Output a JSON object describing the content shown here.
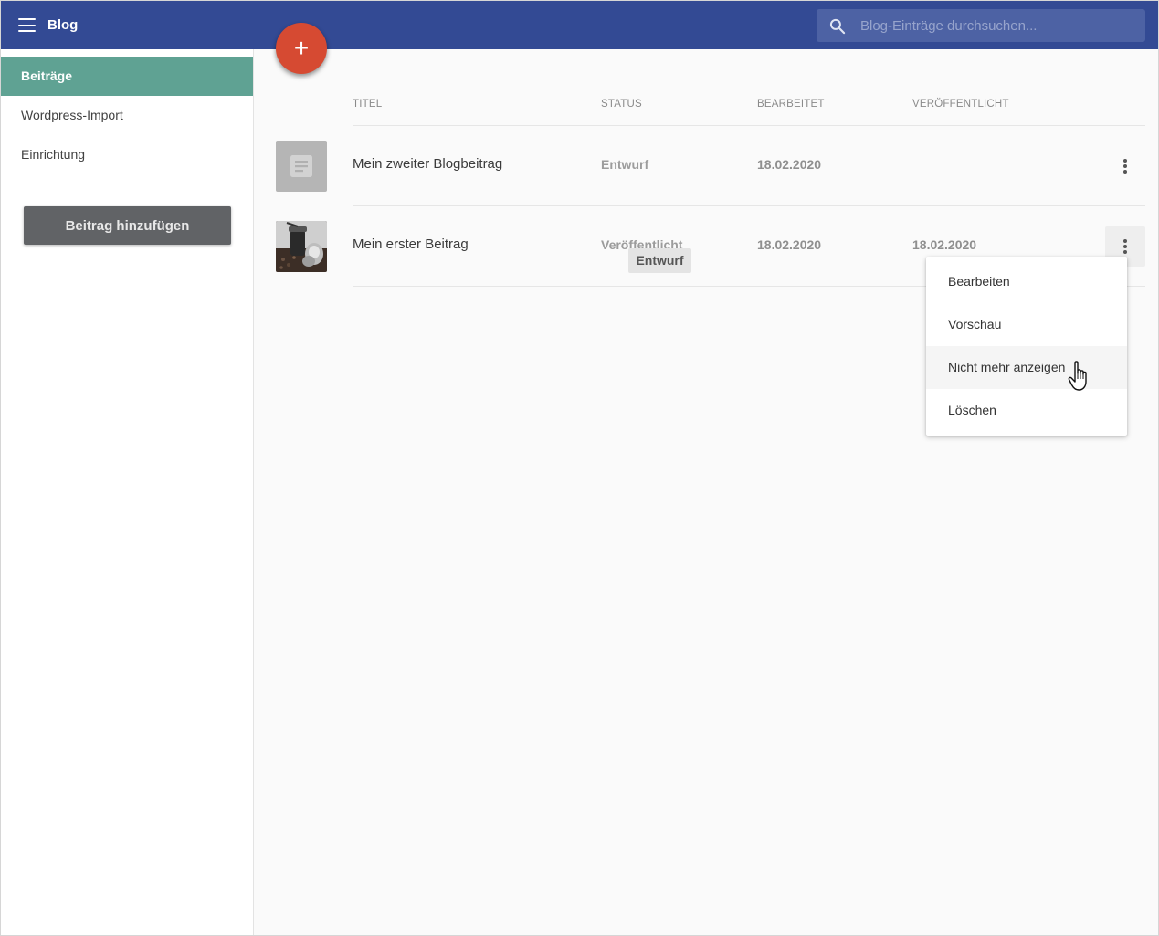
{
  "header": {
    "title": "Blog",
    "search_placeholder": "Blog-Einträge durchsuchen...",
    "background_color": "#334a94"
  },
  "sidebar": {
    "items": [
      {
        "label": "Beiträge",
        "active": true
      },
      {
        "label": "Wordpress-Import",
        "active": false
      },
      {
        "label": "Einrichtung",
        "active": false
      }
    ],
    "add_button_label": "Beitrag hinzufügen",
    "active_color": "#5fa293"
  },
  "fab": {
    "label": "+",
    "color": "#d64a32"
  },
  "table": {
    "columns": [
      "TITEL",
      "STATUS",
      "BEARBEITET",
      "VERÖFFENTLICHT"
    ],
    "rows": [
      {
        "title": "Mein zweiter Blogbeitrag",
        "status": "Entwurf",
        "edited": "18.02.2020",
        "published": "",
        "thumbnail": "placeholder-document-icon"
      },
      {
        "title": "Mein erster Beitrag",
        "status": "Veröffentlicht",
        "edited": "18.02.2020",
        "published": "18.02.2020",
        "thumbnail": "coffee-grinder-photo"
      }
    ]
  },
  "tooltip": {
    "text": "Entwurf"
  },
  "context_menu": {
    "items": [
      {
        "label": "Bearbeiten"
      },
      {
        "label": "Vorschau"
      },
      {
        "label": "Nicht mehr anzeigen",
        "hovered": true
      },
      {
        "label": "Löschen"
      }
    ]
  }
}
